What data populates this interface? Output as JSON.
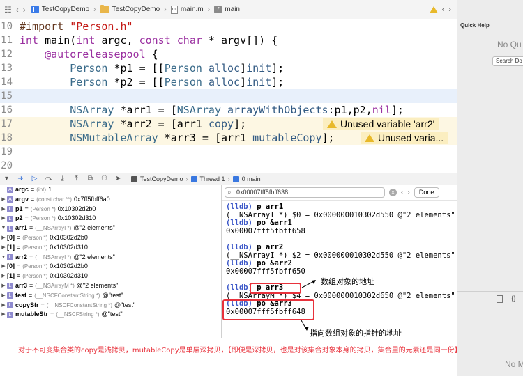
{
  "jumpbar": {
    "crumbs": [
      "TestCopyDemo",
      "TestCopyDemo",
      "main.m",
      "main"
    ]
  },
  "editor": {
    "lines": [
      {
        "num": "10",
        "html": "<span class='pre'>#import </span><span class='str'>\"Person.h\"</span>"
      },
      {
        "num": "11",
        "html": "<span class='kw'>int</span> main(<span class='kw'>int</span> argc, <span class='kw'>const char</span> * argv[]) {"
      },
      {
        "num": "12",
        "html": "    <span class='kw'>@autoreleasepool</span> {"
      },
      {
        "num": "13",
        "html": "        <span class='cls'>Person</span> *p1 = [[<span class='cls'>Person</span> <span class='mth'>alloc</span>]<span class='mth'>init</span>];"
      },
      {
        "num": "14",
        "html": "        <span class='cls'>Person</span> *p2 = [[<span class='cls'>Person</span> <span class='mth'>alloc</span>]<span class='mth'>init</span>];"
      },
      {
        "num": "15",
        "html": "        ",
        "current": true
      },
      {
        "num": "16",
        "html": "        <span class='cls'>NSArray</span> *arr1 = [<span class='cls'>NSArray</span> <span class='mth'>arrayWithObjects</span>:p1,p2,<span class='kw'>nil</span>];"
      },
      {
        "num": "17",
        "html": "        <span class='cls'>NSArray</span> *arr2 = [arr1 <span class='mth'>copy</span>];",
        "warn": true
      },
      {
        "num": "18",
        "html": "        <span class='cls'>NSMutableArray</span> *arr3 = [arr1 <span class='mth'>mutableCopy</span>];",
        "warn": true
      },
      {
        "num": "19",
        "html": ""
      },
      {
        "num": "20",
        "html": ""
      }
    ],
    "warning17": "Unused variable 'arr2'",
    "warning18": "Unused varia..."
  },
  "debugbar": {
    "scheme": "TestCopyDemo",
    "thread": "Thread 1",
    "frame": "0 main"
  },
  "variables": [
    {
      "tri": "",
      "badge": "A",
      "name": "argc",
      "type": "(int)",
      "value": "1"
    },
    {
      "tri": "▶",
      "badge": "A",
      "name": "argv",
      "type": "(const char **)",
      "value": "0x7ff5fbff6a0"
    },
    {
      "tri": "▶",
      "badge": "L",
      "name": "p1",
      "type": "(Person *)",
      "value": "0x10302d2b0"
    },
    {
      "tri": "▶",
      "badge": "L",
      "name": "p2",
      "type": "(Person *)",
      "value": "0x10302d310"
    },
    {
      "tri": "▼",
      "badge": "L",
      "name": "arr1",
      "type": "(__NSArrayI *)",
      "value": "@\"2 elements\""
    },
    {
      "tri": "▶",
      "badge": "",
      "name": "[0]",
      "type": "(Person *)",
      "value": "0x10302d2b0",
      "indent": true
    },
    {
      "tri": "▶",
      "badge": "",
      "name": "[1]",
      "type": "(Person *)",
      "value": "0x10302d310",
      "indent": true
    },
    {
      "tri": "▼",
      "badge": "L",
      "name": "arr2",
      "type": "(__NSArrayI *)",
      "value": "@\"2 elements\""
    },
    {
      "tri": "▶",
      "badge": "",
      "name": "[0]",
      "type": "(Person *)",
      "value": "0x10302d2b0",
      "indent": true
    },
    {
      "tri": "▶",
      "badge": "",
      "name": "[1]",
      "type": "(Person *)",
      "value": "0x10302d310",
      "indent": true
    },
    {
      "tri": "▶",
      "badge": "L",
      "name": "arr3",
      "type": "(__NSArrayM *)",
      "value": "@\"2 elements\""
    },
    {
      "tri": "▶",
      "badge": "L",
      "name": "test",
      "type": "(__NSCFConstantString *)",
      "value": "@\"test\""
    },
    {
      "tri": "▶",
      "badge": "L",
      "name": "copyStr",
      "type": "(__NSCFConstantString *)",
      "value": "@\"test\""
    },
    {
      "tri": "▶",
      "badge": "L",
      "name": "mutableStr",
      "type": "(__NSCFString *)",
      "value": "@\"test\""
    }
  ],
  "console": {
    "search_value": "0x00007fff5fbff638",
    "done_label": "Done",
    "lines": [
      {
        "kind": "prompt",
        "prefix": "(lldb) ",
        "cmd": "p arr1"
      },
      {
        "kind": "out",
        "text": "(__NSArrayI *) $0 = 0x000000010302d550 @\"2 elements\""
      },
      {
        "kind": "prompt",
        "prefix": "(lldb) ",
        "cmd": "po &arr1"
      },
      {
        "kind": "out",
        "text": "0x00007fff5fbff658"
      },
      {
        "kind": "gap",
        "text": ""
      },
      {
        "kind": "prompt",
        "prefix": "(lldb) ",
        "cmd": "p arr2"
      },
      {
        "kind": "out",
        "text": "(__NSArrayI *) $2 = 0x000000010302d550 @\"2 elements\""
      },
      {
        "kind": "prompt",
        "prefix": "(lldb) ",
        "cmd": "po &arr2"
      },
      {
        "kind": "out",
        "text": "0x00007fff5fbff650"
      },
      {
        "kind": "gap",
        "text": ""
      },
      {
        "kind": "prompt",
        "prefix": "(lldb) ",
        "cmd": "p arr3"
      },
      {
        "kind": "out",
        "text": "(__NSArrayM *) $4 = 0x000000010302d650 @\"2 elements\""
      },
      {
        "kind": "prompt",
        "prefix": "(lldb) ",
        "cmd": "po &arr3"
      },
      {
        "kind": "out",
        "text": "0x00007fff5fbff648"
      }
    ]
  },
  "annotations": {
    "array_address": "数组对象的地址",
    "pointer_address": "指向数组对象的指针的地址",
    "summary": "对于不可变集合类的copy是浅拷贝，mutableCopy是单层深拷贝，【即便是深拷贝，也是对该集合对象本身的拷贝，集合里的元素还是同一份】"
  },
  "quick_help": {
    "title": "Quick Help",
    "empty": "No Qu",
    "search": "Search Do",
    "empty2": "No M"
  },
  "colors": {
    "annotation_red": "#e8323c",
    "warning_yellow": "#e8b92a"
  }
}
